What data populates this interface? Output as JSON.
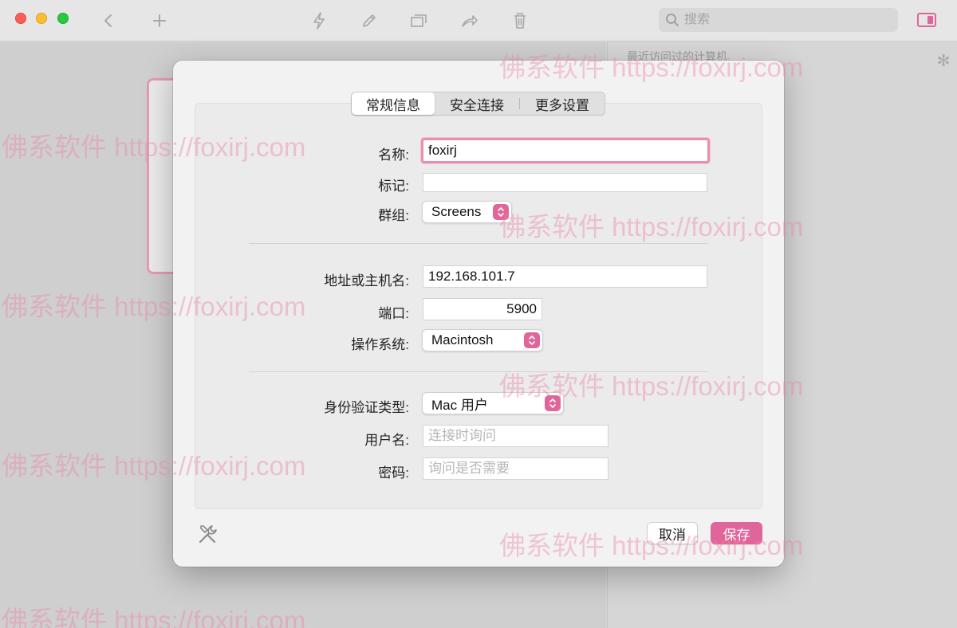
{
  "toolbar": {
    "search_placeholder": "搜索"
  },
  "side_panel": {
    "title": "最近访问过的计算机"
  },
  "dialog": {
    "tabs": [
      {
        "label": "常规信息",
        "active": true
      },
      {
        "label": "安全连接",
        "active": false
      },
      {
        "label": "更多设置",
        "active": false
      }
    ],
    "general": {
      "name_label": "名称:",
      "name_value": "foxirj",
      "tag_label": "标记:",
      "tag_value": "",
      "group_label": "群组:",
      "group_value": "Screens",
      "address_label": "地址或主机名:",
      "address_value": "192.168.101.7",
      "port_label": "端口:",
      "port_value": "5900",
      "os_label": "操作系统:",
      "os_value": "Macintosh",
      "auth_label": "身份验证类型:",
      "auth_value": "Mac 用户",
      "username_label": "用户名:",
      "username_placeholder": "连接时询问",
      "password_label": "密码:",
      "password_placeholder": "询问是否需要"
    },
    "buttons": {
      "cancel": "取消",
      "save": "保存"
    }
  },
  "watermark": "佛系软件 https://foxirj.com",
  "colors": {
    "accent": "#e0669a",
    "focus_ring": "#e68fb1",
    "window_bg": "#d6d6d6",
    "dialog_bg": "#f2f2f2"
  },
  "icons": [
    "back-chevron-icon",
    "add-icon",
    "lightning-icon",
    "pencil-icon",
    "window-icon",
    "share-arrow-icon",
    "trash-icon",
    "search-icon",
    "sidebar-toggle-icon",
    "spinner-icon",
    "tools-icon",
    "updown-chevron-icon"
  ]
}
